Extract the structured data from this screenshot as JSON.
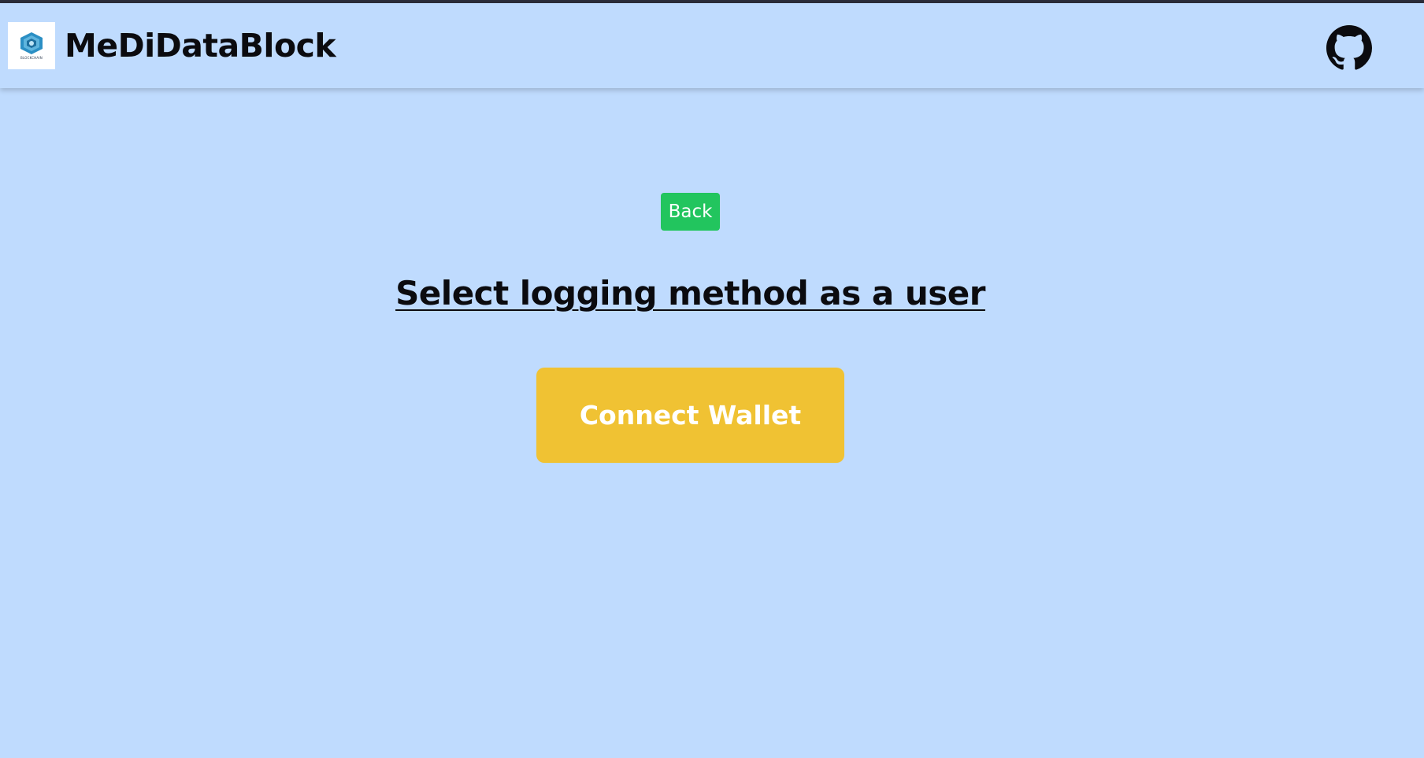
{
  "header": {
    "brand_name": "MeDiDataBlock",
    "logo_caption": "BLOCKCHAIN",
    "logo_icon": "blockchain-cube-logo",
    "github_icon": "github-icon"
  },
  "main": {
    "back_label": "Back",
    "heading": "Select logging method as a user",
    "connect_label": "Connect Wallet"
  },
  "colors": {
    "background": "#bfdbfe",
    "back_button": "#22c55e",
    "connect_button": "#f0c233",
    "text": "#0b0b0f"
  }
}
